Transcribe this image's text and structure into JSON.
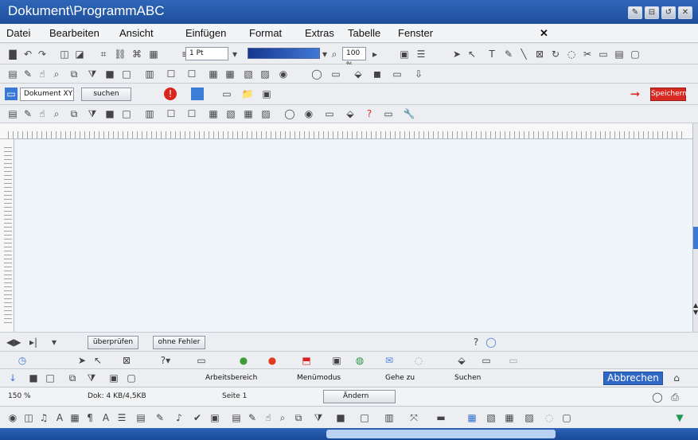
{
  "window": {
    "title": "Dokument\\ProgrammABC",
    "controls": [
      "✎",
      "⊟",
      "↺",
      "✕"
    ]
  },
  "menu": [
    "Datei",
    "Bearbeiten",
    "Ansicht",
    "Einfügen",
    "Format",
    "Extras",
    "Tabelle",
    "Fenster"
  ],
  "menu_close_glyph": "✕",
  "toolbar1": {
    "line_width": "1 Pt",
    "zoom_value": "100 %"
  },
  "toolbar3": {
    "document_field": "Dokument XY",
    "search_button": "suchen",
    "save_button": "Speichern"
  },
  "bottom": {
    "check_button": "überprüfen",
    "no_errors": "ohne Fehler",
    "question_mark": "?",
    "nav_labels": [
      "Arbeitsbereich",
      "Menümodus",
      "Gehe zu",
      "Suchen"
    ],
    "cancel_button": "Abbrechen"
  },
  "status": {
    "zoom": "150 %",
    "document": "Dok: 4 KB/4,5KB",
    "page": "Seite 1",
    "change": "Ändern"
  },
  "colors": {
    "title_blue": "#245aa9",
    "accent_blue": "#2f67c4",
    "save_red": "#d82a22"
  }
}
